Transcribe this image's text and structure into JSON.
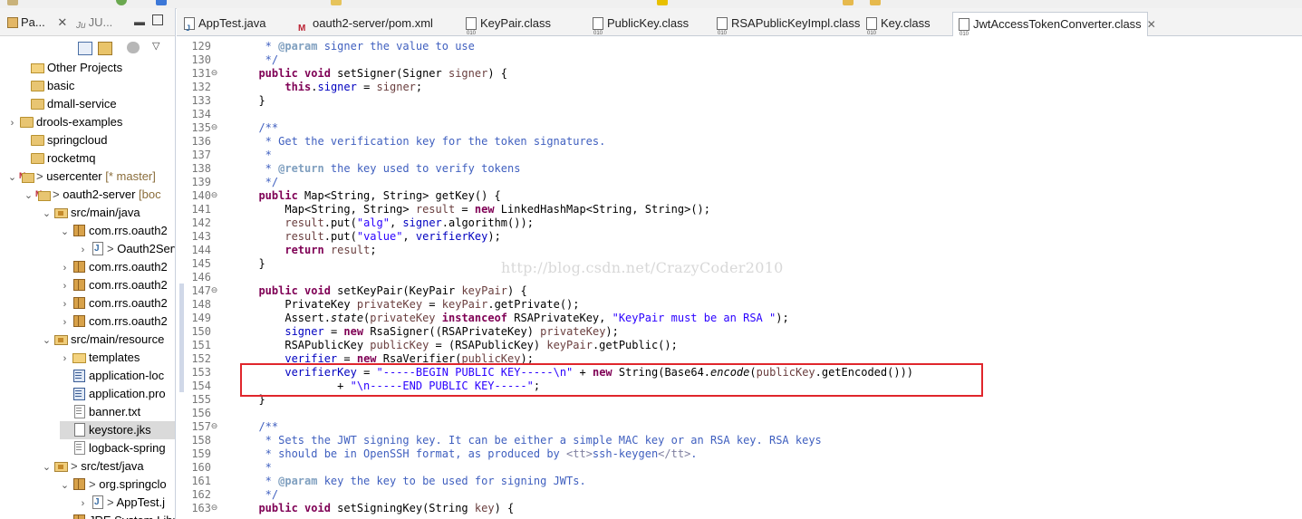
{
  "explorer": {
    "tabs": [
      {
        "label": "Pa...",
        "icon": "package-explorer-icon",
        "has_close": true
      },
      {
        "label": "JU...",
        "icon": "junit-icon"
      }
    ],
    "tree": [
      {
        "label": "Other Projects",
        "icon": "working-set-icon",
        "expanded": null
      },
      {
        "label": "basic",
        "icon": "project-icon",
        "expanded": null
      },
      {
        "label": "dmall-service",
        "icon": "project-icon",
        "expanded": null
      },
      {
        "label": "drools-examples",
        "icon": "project-icon",
        "expanded": false
      },
      {
        "label": "springcloud",
        "icon": "project-icon",
        "expanded": null
      },
      {
        "label": "rocketmq",
        "icon": "project-icon",
        "expanded": null
      },
      {
        "label": "usercenter",
        "prefix": "> ",
        "decoration": " [* master]",
        "icon": "maven-project-icon",
        "expanded": true
      },
      {
        "label": "oauth2-server",
        "prefix": "> ",
        "decoration": " [boc",
        "icon": "maven-project-icon",
        "expanded": true
      },
      {
        "label": "src/main/java",
        "icon": "source-folder-icon",
        "expanded": true
      },
      {
        "label": "com.rrs.oauth2",
        "icon": "package-icon",
        "expanded": true
      },
      {
        "label": "Oauth2Serv",
        "prefix": "> ",
        "icon": "java-file-icon",
        "expanded": false
      },
      {
        "label": "com.rrs.oauth2",
        "icon": "package-icon",
        "expanded": false
      },
      {
        "label": "com.rrs.oauth2",
        "icon": "package-icon",
        "expanded": false
      },
      {
        "label": "com.rrs.oauth2",
        "icon": "package-icon",
        "expanded": false
      },
      {
        "label": "com.rrs.oauth2",
        "icon": "package-icon",
        "expanded": false
      },
      {
        "label": "src/main/resource",
        "icon": "source-folder-icon",
        "expanded": true
      },
      {
        "label": "templates",
        "icon": "folder-icon",
        "expanded": false
      },
      {
        "label": "application-loc",
        "icon": "properties-file-icon",
        "expanded": null
      },
      {
        "label": "application.pro",
        "icon": "properties-file-icon",
        "expanded": null
      },
      {
        "label": "banner.txt",
        "icon": "text-file-icon",
        "expanded": null
      },
      {
        "label": "keystore.jks",
        "icon": "keystore-file-icon",
        "expanded": null,
        "selected": true
      },
      {
        "label": "logback-spring",
        "icon": "xml-file-icon",
        "expanded": null
      },
      {
        "label": "src/test/java",
        "prefix": "> ",
        "icon": "source-folder-icon",
        "expanded": true
      },
      {
        "label": "org.springclo",
        "prefix": "> ",
        "icon": "package-icon",
        "expanded": true
      },
      {
        "label": "AppTest.j",
        "prefix": "> ",
        "icon": "java-file-icon",
        "expanded": false
      },
      {
        "label": "JRE System Libr",
        "icon": "library-icon",
        "expanded": false
      }
    ]
  },
  "editor": {
    "tabs": [
      {
        "label": "AppTest.java",
        "icon": "java-file-icon"
      },
      {
        "label": "oauth2-server/pom.xml",
        "icon": "maven-pom-icon"
      },
      {
        "label": "KeyPair.class",
        "icon": "class-file-icon"
      },
      {
        "label": "PublicKey.class",
        "icon": "class-file-icon"
      },
      {
        "label": "RSAPublicKeyImpl.class",
        "icon": "class-file-icon"
      },
      {
        "label": "Key.class",
        "icon": "class-file-icon"
      },
      {
        "label": "JwtAccessTokenConverter.class",
        "icon": "class-file-icon",
        "active": true,
        "close": "✕"
      }
    ],
    "watermark": "http://blog.csdn.net/CrazyCoder2010",
    "lines": [
      {
        "n": "129",
        "fold": "",
        "tokens": [
          [
            "cm",
            "   * "
          ],
          [
            "tag",
            "@param"
          ],
          [
            "cm",
            " signer the value to use"
          ]
        ]
      },
      {
        "n": "130",
        "fold": "",
        "tokens": [
          [
            "cm",
            "   */"
          ]
        ]
      },
      {
        "n": "131",
        "fold": "⊖",
        "tokens": [
          [
            "",
            "  "
          ],
          [
            "kw",
            "public void"
          ],
          [
            "",
            " setSigner(Signer "
          ],
          [
            "lv",
            "signer"
          ],
          [
            "",
            ") {"
          ]
        ]
      },
      {
        "n": "132",
        "fold": "",
        "tokens": [
          [
            "",
            "      "
          ],
          [
            "kw",
            "this"
          ],
          [
            "",
            "."
          ],
          [
            "fld",
            "signer"
          ],
          [
            "",
            " = "
          ],
          [
            "lv",
            "signer"
          ],
          [
            "",
            ";"
          ]
        ]
      },
      {
        "n": "133",
        "fold": "",
        "tokens": [
          [
            "",
            "  }"
          ]
        ]
      },
      {
        "n": "134",
        "fold": "",
        "tokens": [
          [
            "",
            ""
          ]
        ]
      },
      {
        "n": "135",
        "fold": "⊖",
        "tokens": [
          [
            "cm",
            "  /**"
          ]
        ]
      },
      {
        "n": "136",
        "fold": "",
        "tokens": [
          [
            "cm",
            "   * Get the verification key for the token signatures."
          ]
        ]
      },
      {
        "n": "137",
        "fold": "",
        "tokens": [
          [
            "cm",
            "   *"
          ]
        ]
      },
      {
        "n": "138",
        "fold": "",
        "tokens": [
          [
            "cm",
            "   * "
          ],
          [
            "tag",
            "@return"
          ],
          [
            "cm",
            " the key used to verify tokens"
          ]
        ]
      },
      {
        "n": "139",
        "fold": "",
        "tokens": [
          [
            "cm",
            "   */"
          ]
        ]
      },
      {
        "n": "140",
        "fold": "⊖",
        "tokens": [
          [
            "",
            "  "
          ],
          [
            "kw",
            "public"
          ],
          [
            "",
            " Map<String, String> getKey() {"
          ]
        ]
      },
      {
        "n": "141",
        "fold": "",
        "tokens": [
          [
            "",
            "      Map<String, String> "
          ],
          [
            "lv",
            "result"
          ],
          [
            "",
            " = "
          ],
          [
            "kw",
            "new"
          ],
          [
            "",
            " LinkedHashMap<String, String>();"
          ]
        ]
      },
      {
        "n": "142",
        "fold": "",
        "tokens": [
          [
            "",
            "      "
          ],
          [
            "lv",
            "result"
          ],
          [
            "",
            ".put("
          ],
          [
            "str",
            "\"alg\""
          ],
          [
            "",
            ", "
          ],
          [
            "fld",
            "signer"
          ],
          [
            "",
            ".algorithm());"
          ]
        ]
      },
      {
        "n": "143",
        "fold": "",
        "tokens": [
          [
            "",
            "      "
          ],
          [
            "lv",
            "result"
          ],
          [
            "",
            ".put("
          ],
          [
            "str",
            "\"value\""
          ],
          [
            "",
            ", "
          ],
          [
            "fld",
            "verifierKey"
          ],
          [
            "",
            ");"
          ]
        ]
      },
      {
        "n": "144",
        "fold": "",
        "tokens": [
          [
            "",
            "      "
          ],
          [
            "kw",
            "return"
          ],
          [
            "",
            " "
          ],
          [
            "lv",
            "result"
          ],
          [
            "",
            ";"
          ]
        ]
      },
      {
        "n": "145",
        "fold": "",
        "tokens": [
          [
            "",
            "  }"
          ]
        ]
      },
      {
        "n": "146",
        "fold": "",
        "tokens": [
          [
            "",
            ""
          ]
        ]
      },
      {
        "n": "147",
        "fold": "⊖",
        "tokens": [
          [
            "",
            "  "
          ],
          [
            "kw",
            "public void"
          ],
          [
            "",
            " setKeyPair(KeyPair "
          ],
          [
            "lv",
            "keyPair"
          ],
          [
            "",
            ") {"
          ]
        ]
      },
      {
        "n": "148",
        "fold": "",
        "tokens": [
          [
            "",
            "      PrivateKey "
          ],
          [
            "lv",
            "privateKey"
          ],
          [
            "",
            " = "
          ],
          [
            "lv",
            "keyPair"
          ],
          [
            "",
            ".getPrivate();"
          ]
        ]
      },
      {
        "n": "149",
        "fold": "",
        "tokens": [
          [
            "",
            "      Assert."
          ],
          [
            "ital",
            "state"
          ],
          [
            "",
            "("
          ],
          [
            "lv",
            "privateKey"
          ],
          [
            "",
            " "
          ],
          [
            "kw",
            "instanceof"
          ],
          [
            "",
            " RSAPrivateKey, "
          ],
          [
            "str",
            "\"KeyPair must be an RSA \""
          ],
          [
            "",
            ");"
          ]
        ]
      },
      {
        "n": "150",
        "fold": "",
        "tokens": [
          [
            "",
            "      "
          ],
          [
            "fld",
            "signer"
          ],
          [
            "",
            " = "
          ],
          [
            "kw",
            "new"
          ],
          [
            "",
            " RsaSigner((RSAPrivateKey) "
          ],
          [
            "lv",
            "privateKey"
          ],
          [
            "",
            ");"
          ]
        ]
      },
      {
        "n": "151",
        "fold": "",
        "tokens": [
          [
            "",
            "      RSAPublicKey "
          ],
          [
            "lv",
            "publicKey"
          ],
          [
            "",
            " = (RSAPublicKey) "
          ],
          [
            "lv",
            "keyPair"
          ],
          [
            "",
            ".getPublic();"
          ]
        ]
      },
      {
        "n": "152",
        "fold": "",
        "tokens": [
          [
            "",
            "      "
          ],
          [
            "fld",
            "verifier"
          ],
          [
            "",
            " = "
          ],
          [
            "kw",
            "new"
          ],
          [
            "",
            " RsaVerifier("
          ],
          [
            "lv",
            "publicKey"
          ],
          [
            "",
            ");"
          ]
        ]
      },
      {
        "n": "153",
        "fold": "",
        "tokens": [
          [
            "",
            "      "
          ],
          [
            "fld",
            "verifierKey"
          ],
          [
            "",
            " = "
          ],
          [
            "str",
            "\"-----BEGIN PUBLIC KEY-----\\n\""
          ],
          [
            "",
            " + "
          ],
          [
            "kw",
            "new"
          ],
          [
            "",
            " String(Base64."
          ],
          [
            "ital",
            "encode"
          ],
          [
            "",
            "("
          ],
          [
            "lv",
            "publicKey"
          ],
          [
            "",
            ".getEncoded()))"
          ]
        ]
      },
      {
        "n": "154",
        "fold": "",
        "tokens": [
          [
            "",
            "              + "
          ],
          [
            "str",
            "\"\\n-----END PUBLIC KEY-----\""
          ],
          [
            "",
            ";"
          ]
        ]
      },
      {
        "n": "155",
        "fold": "",
        "tokens": [
          [
            "",
            "  }"
          ]
        ]
      },
      {
        "n": "156",
        "fold": "",
        "tokens": [
          [
            "",
            ""
          ]
        ]
      },
      {
        "n": "157",
        "fold": "⊖",
        "tokens": [
          [
            "cm",
            "  /**"
          ]
        ]
      },
      {
        "n": "158",
        "fold": "",
        "tokens": [
          [
            "cm",
            "   * Sets the JWT signing key. It can be either a simple MAC key or an RSA key. RSA keys"
          ]
        ]
      },
      {
        "n": "159",
        "fold": "",
        "tokens": [
          [
            "cm",
            "   * should be in OpenSSH format, as produced by "
          ],
          [
            "html",
            "<tt>"
          ],
          [
            "cm",
            "ssh-keygen"
          ],
          [
            "html",
            "</tt>"
          ],
          [
            "cm",
            "."
          ]
        ]
      },
      {
        "n": "160",
        "fold": "",
        "tokens": [
          [
            "cm",
            "   *"
          ]
        ]
      },
      {
        "n": "161",
        "fold": "",
        "tokens": [
          [
            "cm",
            "   * "
          ],
          [
            "tag",
            "@param"
          ],
          [
            "cm",
            " key the key to be used for signing JWTs."
          ]
        ]
      },
      {
        "n": "162",
        "fold": "",
        "tokens": [
          [
            "cm",
            "   */"
          ]
        ]
      },
      {
        "n": "163",
        "fold": "⊖",
        "tokens": [
          [
            "",
            "  "
          ],
          [
            "kw",
            "public void"
          ],
          [
            "",
            " setSigningKey(String "
          ],
          [
            "lv",
            "key"
          ],
          [
            "",
            ") {"
          ]
        ]
      }
    ]
  },
  "colors": {
    "keyword": "#7f0055",
    "comment": "#3f5fbf",
    "string": "#2a00ff",
    "field": "#0000c0",
    "local": "#6a3e3e",
    "highlight_box": "#e0262c"
  }
}
